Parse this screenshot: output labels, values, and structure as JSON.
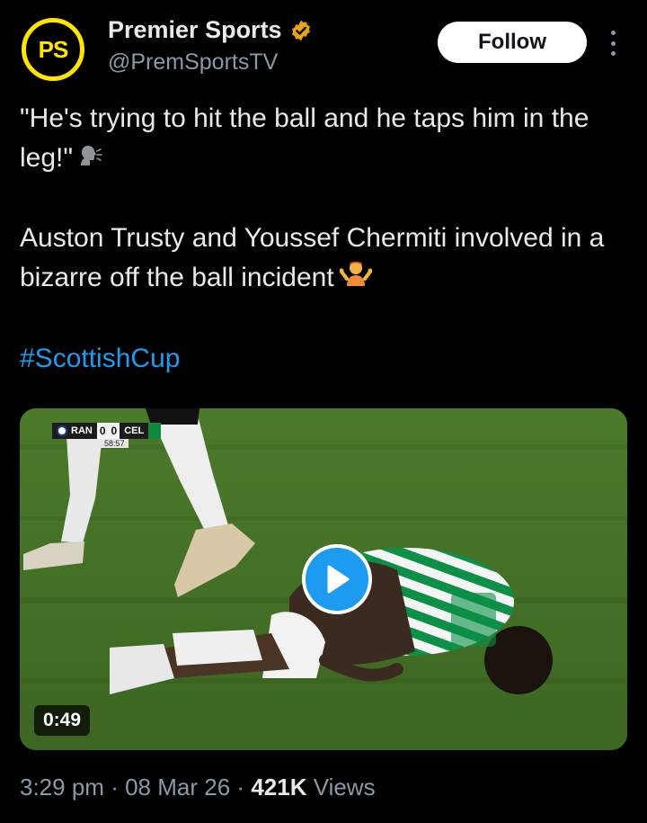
{
  "author": {
    "avatar_text": "PS",
    "display_name": "Premier Sports",
    "handle": "@PremSportsTV",
    "verified": true,
    "avatar_color": "#ffe600",
    "badge_color": "#e8a317"
  },
  "actions": {
    "follow_label": "Follow",
    "more_icon": "more-vertical-icon"
  },
  "tweet": {
    "line1": "\"He's trying to hit the ball and he taps him in the leg!\"",
    "line1_emoji": "speaking-head-emoji",
    "line2": "Auston Trusty and Youssef Chermiti involved in a bizarre off the ball incident",
    "line2_emoji": "person-shrugging-emoji",
    "hashtag": "#ScottishCup",
    "hashtag_color": "#1d9bf0"
  },
  "media": {
    "type": "video",
    "duration": "0:49",
    "play_icon": "play-icon",
    "scorebug": {
      "home": "RAN",
      "home_score": "0",
      "away_score": "0",
      "away": "CEL",
      "clock": "58:57"
    },
    "accent_color": "#1d9bf0"
  },
  "meta": {
    "time": "3:29 pm",
    "separator": "·",
    "date": "08 Mar 26",
    "views_count": "421K",
    "views_label": "Views"
  }
}
